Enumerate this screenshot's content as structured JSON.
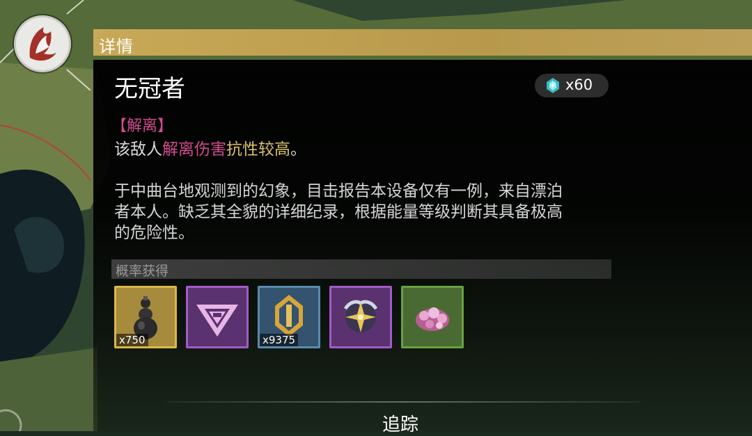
{
  "header": {
    "title": "详情"
  },
  "enemy": {
    "name": "无冠者",
    "attribute_tag": "【解离】",
    "resist_parts": [
      "该敌人",
      "解离伤害",
      "抗性较高",
      "。"
    ],
    "lore_lines": [
      "于中曲台地观测到的幻象，目击报告本设备仅有一例，来自漂泊",
      "者本人。缺乏其全貌的详细纪录，根据能量等级判断其具备极高",
      "的危险性。"
    ]
  },
  "currency": {
    "icon": "cyan-crystal-icon",
    "count": "x60"
  },
  "drops": {
    "label": "概率获得",
    "items": [
      {
        "icon": "gourd-icon",
        "rarity": "gold",
        "qty": "x750"
      },
      {
        "icon": "purple-emblem-icon",
        "rarity": "purple",
        "qty": ""
      },
      {
        "icon": "gold-shell-credit-icon",
        "rarity": "blue",
        "qty": "x9375"
      },
      {
        "icon": "star-crown-core-icon",
        "rarity": "purple",
        "qty": ""
      },
      {
        "icon": "pink-flower-cluster-icon",
        "rarity": "green",
        "qty": ""
      }
    ]
  },
  "track_button": {
    "label": "追踪"
  },
  "colors": {
    "header": "#c8a957",
    "havoc": "#d24c8e",
    "highlight": "#dcc06a"
  }
}
